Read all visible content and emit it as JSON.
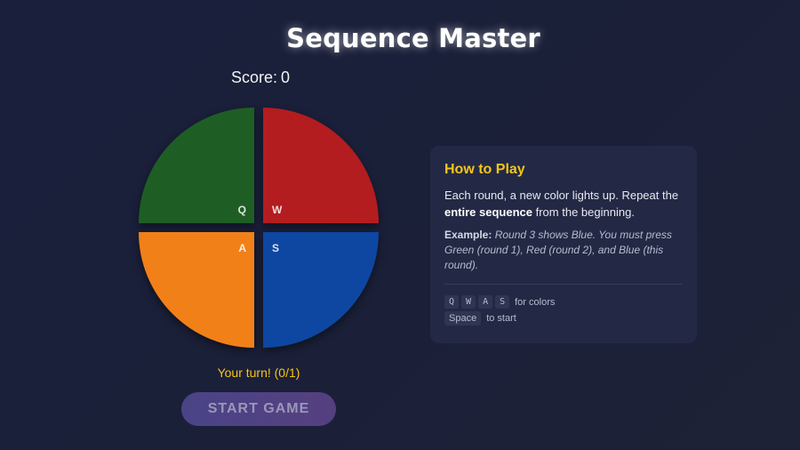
{
  "title": "Sequence Master",
  "score": {
    "label": "Score:",
    "value": "0"
  },
  "pads": [
    {
      "color_name": "Green",
      "key": "Q",
      "color": "#1e5e24"
    },
    {
      "color_name": "Red",
      "key": "W",
      "color": "#b31d1f"
    },
    {
      "color_name": "Orange",
      "key": "A",
      "color": "#f28018"
    },
    {
      "color_name": "Blue",
      "key": "S",
      "color": "#0d47a1"
    }
  ],
  "status": "Your turn! (0/1)",
  "start_button": "START GAME",
  "how_to_play": {
    "heading": "How to Play",
    "intro_before": "Each round, a new color lights up. Repeat the ",
    "intro_bold": "entire sequence",
    "intro_after": " from the beginning.",
    "example_label": "Example:",
    "example_text": " Round 3 shows Blue. You must press Green (round 1), Red (round 2), and Blue (this round).",
    "keys": [
      "Q",
      "W",
      "A",
      "S"
    ],
    "keys_desc": "for colors",
    "space_key": "Space",
    "space_desc": "to start"
  },
  "colors": {
    "background": "#1a1f3c",
    "accent": "#f5c518",
    "panel": "#232945"
  }
}
